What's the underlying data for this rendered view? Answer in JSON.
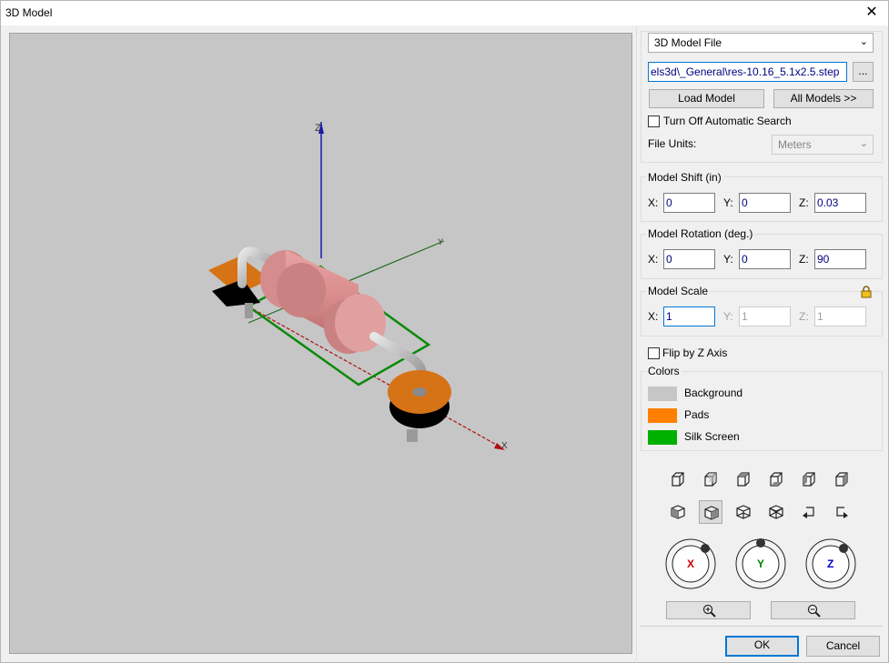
{
  "window": {
    "title": "3D Model",
    "close_label": "✕"
  },
  "model_source": {
    "selected": "3D Model File",
    "path": "els3d\\_General\\res-10.16_5.1x2.5.step",
    "browse_label": "...",
    "load_label": "Load Model",
    "all_models_label": "All Models >>",
    "auto_search_label": "Turn Off Automatic Search",
    "file_units_label": "File Units:",
    "file_units_value": "Meters"
  },
  "model_shift": {
    "title": "Model Shift (in)",
    "x_label": "X:",
    "y_label": "Y:",
    "z_label": "Z:",
    "x": "0",
    "y": "0",
    "z": "0.03"
  },
  "model_rotation": {
    "title": "Model Rotation (deg.)",
    "x_label": "X:",
    "y_label": "Y:",
    "z_label": "Z:",
    "x": "0",
    "y": "0",
    "z": "90"
  },
  "model_scale": {
    "title": "Model Scale",
    "x_label": "X:",
    "y_label": "Y:",
    "z_label": "Z:",
    "x": "1",
    "y": "1",
    "z": "1"
  },
  "flip_label": "Flip by Z Axis",
  "colors": {
    "title": "Colors",
    "items": [
      {
        "label": "Background",
        "color": "#c6c6c6"
      },
      {
        "label": "Pads",
        "color": "#ff8000"
      },
      {
        "label": "Silk Screen",
        "color": "#00b000"
      }
    ]
  },
  "rotation_dials": {
    "x": "X",
    "y": "Y",
    "z": "Z"
  },
  "axis_labels": {
    "z": "Z",
    "y": "Y",
    "x": "X"
  },
  "footer": {
    "ok_label": "OK",
    "cancel_label": "Cancel"
  },
  "accent": "#0078d7"
}
